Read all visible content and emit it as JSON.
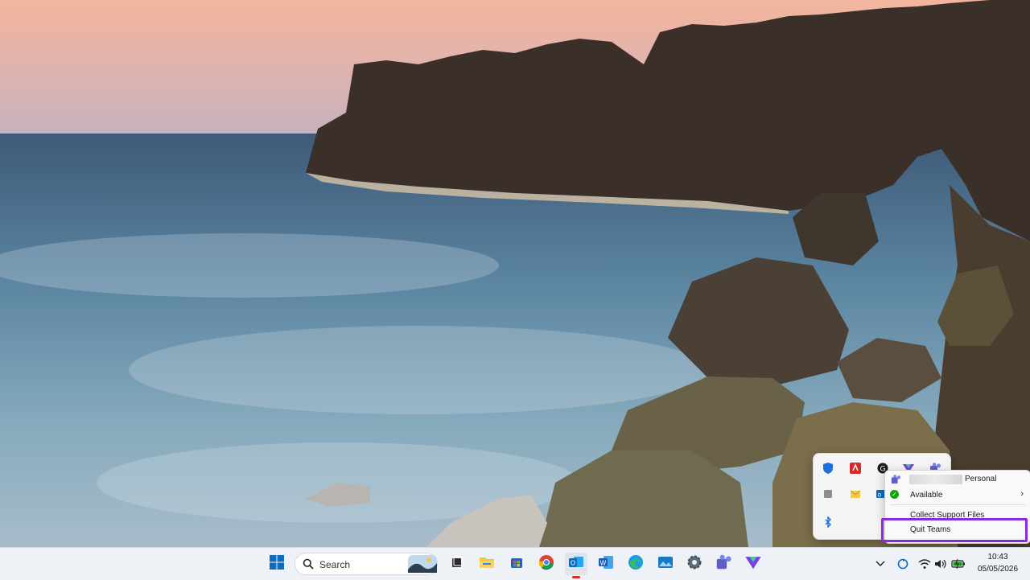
{
  "tray_flyout": {
    "icons": [
      "defender-icon",
      "acrobat-icon",
      "grammarly-icon",
      "vpn-icon",
      "teams-icon",
      "stop-icon",
      "mail-icon",
      "outlook-icon",
      "bluetooth-icon"
    ]
  },
  "context_menu": {
    "account_label": "Personal",
    "status_label": "Available",
    "collect_label": "Collect Support Files",
    "quit_label": "Quit Teams"
  },
  "taskbar": {
    "search_label": "Search",
    "apps": [
      "start-icon",
      "task-view-icon",
      "file-explorer-icon",
      "store-icon",
      "chrome-icon",
      "outlook-icon",
      "word-icon",
      "edge-icon",
      "photos-icon",
      "settings-icon",
      "teams-icon",
      "vpn-icon"
    ],
    "time": "10:43",
    "date": "05/05/2026"
  },
  "colors": {
    "highlight": "#8a2be2",
    "available": "#13a10e",
    "taskbar_bg": "#eef1f6"
  }
}
